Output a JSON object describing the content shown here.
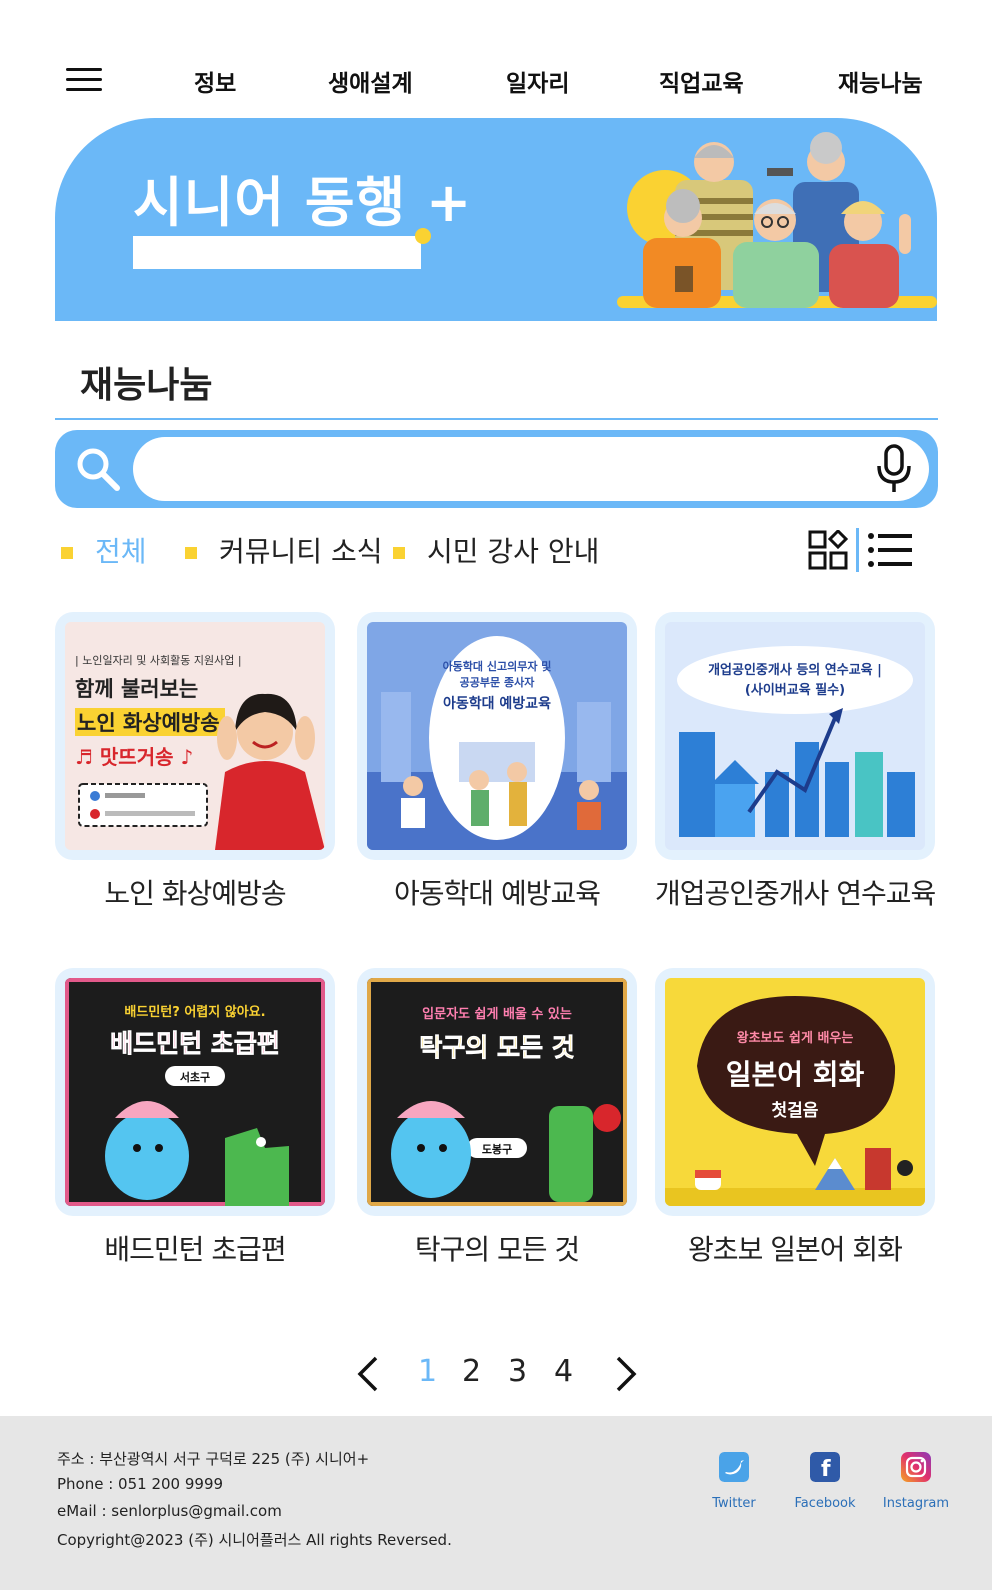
{
  "nav": {
    "items": [
      "정보",
      "생애설계",
      "일자리",
      "직업교육",
      "재능나눔"
    ]
  },
  "banner": {
    "title": "시니어 동행 +"
  },
  "section": {
    "title": "재능나눔"
  },
  "search": {
    "value": "",
    "placeholder": ""
  },
  "filters": [
    {
      "label": "전체",
      "active": true
    },
    {
      "label": "커뮤니티 소식",
      "active": false
    },
    {
      "label": "시민 강사 안내",
      "active": false
    }
  ],
  "cards": [
    {
      "title": "노인 화상예방송",
      "image_text": [
        "| 노인일자리 및 사회활동 지원사업 |",
        "함께 불러보는",
        "노인 화상예방송",
        "♬ 맛뜨거송 ♪"
      ]
    },
    {
      "title": "아동학대 예방교육",
      "image_text": [
        "아동학대 신고의무자 및",
        "공공부문 종사자",
        "아동학대 예방교육"
      ]
    },
    {
      "title": "개업공인중개사 연수교육",
      "image_text": [
        "개업공인중개사 등의 연수교육 |",
        "(사이버교육 필수)"
      ]
    },
    {
      "title": "배드민턴 초급편",
      "image_text": [
        "배드민턴? 어렵지 않아요.",
        "배드민턴 초급편",
        "서초구"
      ]
    },
    {
      "title": "탁구의 모든 것",
      "image_text": [
        "입문자도 쉽게 배울 수 있는",
        "탁구의 모든 것",
        "도봉구"
      ]
    },
    {
      "title": "왕초보 일본어 회화",
      "image_text": [
        "왕초보도 쉽게 배우는",
        "일본어 회화",
        "첫걸음"
      ]
    }
  ],
  "pagination": {
    "pages": [
      "1",
      "2",
      "3",
      "4"
    ],
    "current": "1"
  },
  "footer": {
    "address": "주소 : 부산광역시 서구 구덕로 225 (주) 시니어+",
    "phone": "Phone : 051 200 9999",
    "email": "eMail : senlorplus@gmail.com",
    "copyright": "Copyright@2023 (주) 시니어플러스 All rights Reversed.",
    "social": [
      "Twitter",
      "Facebook",
      "Instagram"
    ]
  },
  "colors": {
    "primary": "#6bb8f7",
    "accent": "#fad232",
    "footer_bg": "#e6e6e6",
    "card_bg": "#e3f1fd"
  }
}
